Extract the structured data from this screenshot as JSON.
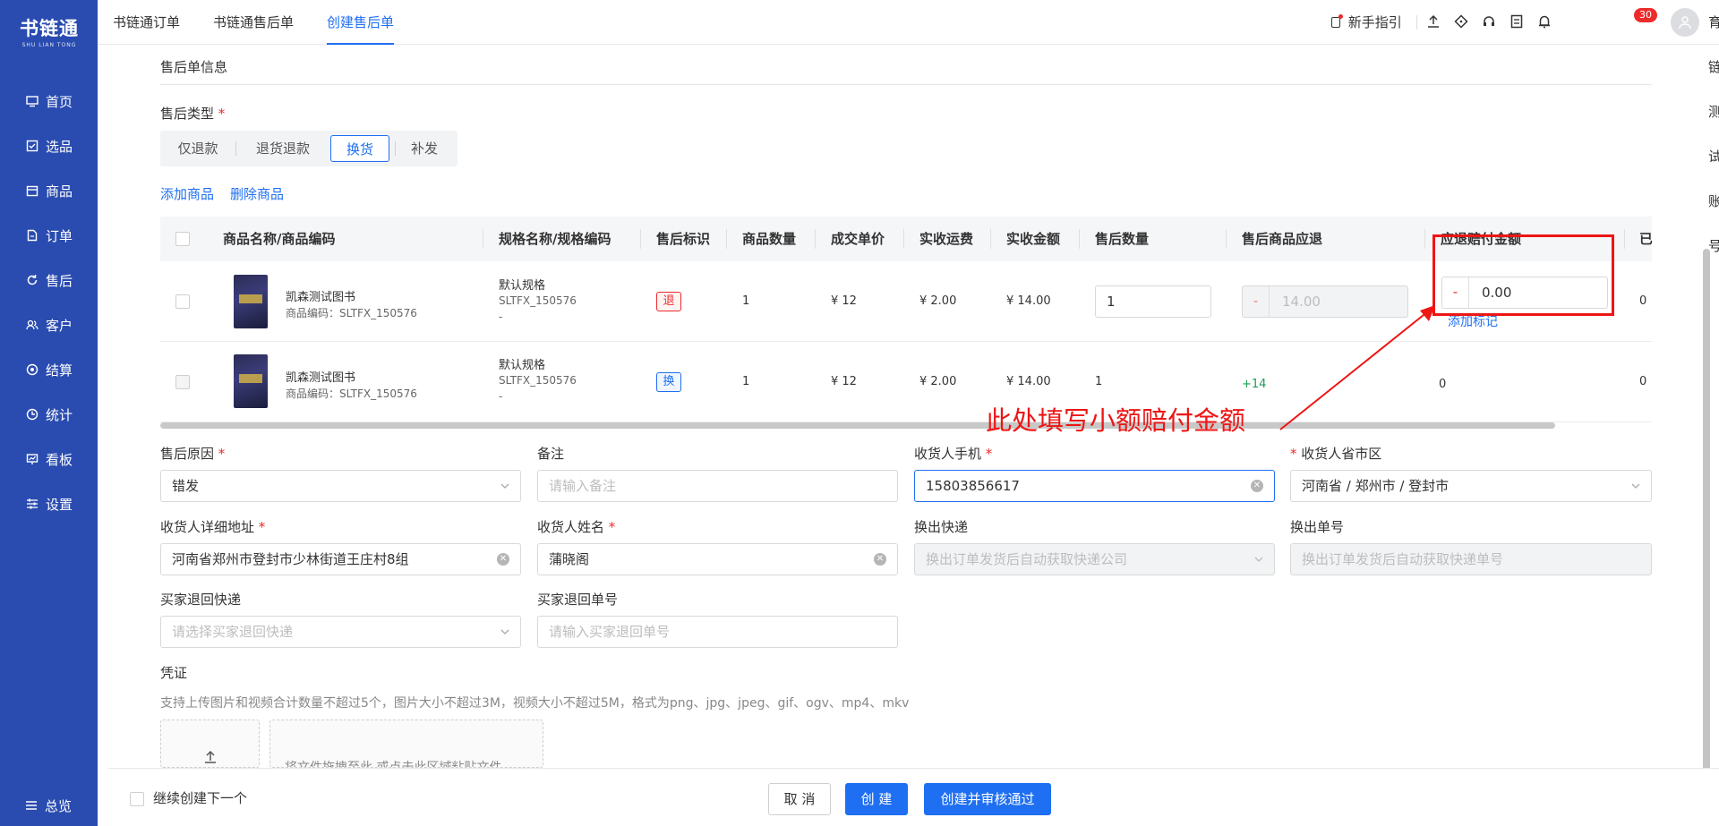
{
  "brand": {
    "name": "书链通",
    "sub": "SHU LIAN TONG"
  },
  "sidebar": {
    "items": [
      {
        "label": "首页",
        "icon": "monitor-icon"
      },
      {
        "label": "选品",
        "icon": "checklist-icon"
      },
      {
        "label": "商品",
        "icon": "box-icon"
      },
      {
        "label": "订单",
        "icon": "document-icon"
      },
      {
        "label": "售后",
        "icon": "refresh-icon"
      },
      {
        "label": "客户",
        "icon": "users-icon"
      },
      {
        "label": "结算",
        "icon": "settlement-icon"
      },
      {
        "label": "统计",
        "icon": "clock-chart-icon"
      },
      {
        "label": "看板",
        "icon": "dashboard-icon"
      },
      {
        "label": "设置",
        "icon": "sliders-icon"
      }
    ],
    "collapse_label": "总览"
  },
  "topbar": {
    "tabs": [
      {
        "label": "书链通订单",
        "active": false
      },
      {
        "label": "书链通售后单",
        "active": false
      },
      {
        "label": "创建售后单",
        "active": true
      }
    ],
    "guide_label": "新手指引",
    "notification_count": "30",
    "account_name": "育链测试账号"
  },
  "form": {
    "section_title": "售后单信息",
    "type_label": "售后类型",
    "type_options": [
      "仅退款",
      "退货退款",
      "换货",
      "补发"
    ],
    "type_selected": "换货",
    "add_goods": "添加商品",
    "remove_goods": "删除商品"
  },
  "table": {
    "headers": [
      "商品名称/商品编码",
      "规格名称/规格编码",
      "售后标识",
      "商品数量",
      "成交单价",
      "实收运费",
      "实收金额",
      "售后数量",
      "售后商品应退",
      "应退赔付金额",
      "已"
    ],
    "rows": [
      {
        "name": "凯森测试图书",
        "code": "商品编码：SLTFX_150576",
        "spec_name": "默认规格",
        "spec_code": "SLTFX_150576",
        "spec_extra": "-",
        "tag": "退",
        "qty": "1",
        "price": "¥ 12",
        "freight": "¥ 2.00",
        "amount": "¥ 14.00",
        "aftersale_qty": "1",
        "refund_minus": "-",
        "refund_value": "14.00",
        "comp_minus": "-",
        "comp_value": "0.00",
        "add_remark": "添加标记",
        "last": "0"
      },
      {
        "name": "凯森测试图书",
        "code": "商品编码：SLTFX_150576",
        "spec_name": "默认规格",
        "spec_code": "SLTFX_150576",
        "spec_extra": "-",
        "tag": "换",
        "qty": "1",
        "price": "¥ 12",
        "freight": "¥ 2.00",
        "amount": "¥ 14.00",
        "aftersale_qty": "1",
        "refund": "+14",
        "comp": "0",
        "last": "0"
      }
    ]
  },
  "annotation": "此处填写小额赔付金额",
  "fields": {
    "reason": {
      "label": "售后原因",
      "value": "错发"
    },
    "remark": {
      "label": "备注",
      "placeholder": "请输入备注"
    },
    "phone": {
      "label": "收货人手机",
      "value": "15803856617"
    },
    "region": {
      "label": "收货人省市区",
      "value": "河南省 / 郑州市 / 登封市"
    },
    "address": {
      "label": "收货人详细地址",
      "value": "河南省郑州市登封市少林街道王庄村8组"
    },
    "receiver": {
      "label": "收货人姓名",
      "value": "蒲晓阁"
    },
    "out_express": {
      "label": "换出快递",
      "placeholder": "换出订单发货后自动获取快递公司"
    },
    "out_no": {
      "label": "换出单号",
      "placeholder": "换出订单发货后自动获取快递单号"
    },
    "return_express": {
      "label": "买家退回快递",
      "placeholder": "请选择买家退回快递"
    },
    "return_no": {
      "label": "买家退回单号",
      "placeholder": "请输入买家退回单号"
    },
    "voucher": {
      "label": "凭证",
      "hint": "支持上传图片和视频合计数量不超过5个，图片大小不超过3M，视频大小不超过5M，格式为png、jpg、jpeg、gif、ogv、mp4、mkv",
      "drop_text": "将文件拖拽至此,或点击此区域粘贴文件"
    }
  },
  "footer": {
    "continue_label": "继续创建下一个",
    "cancel": "取 消",
    "create": "创 建",
    "create_approve": "创建并审核通过"
  },
  "colors": {
    "sidebar": "#2a4cb0",
    "primary": "#1f6ff2",
    "danger": "#ee2b2b",
    "annotation": "#ee1515"
  }
}
